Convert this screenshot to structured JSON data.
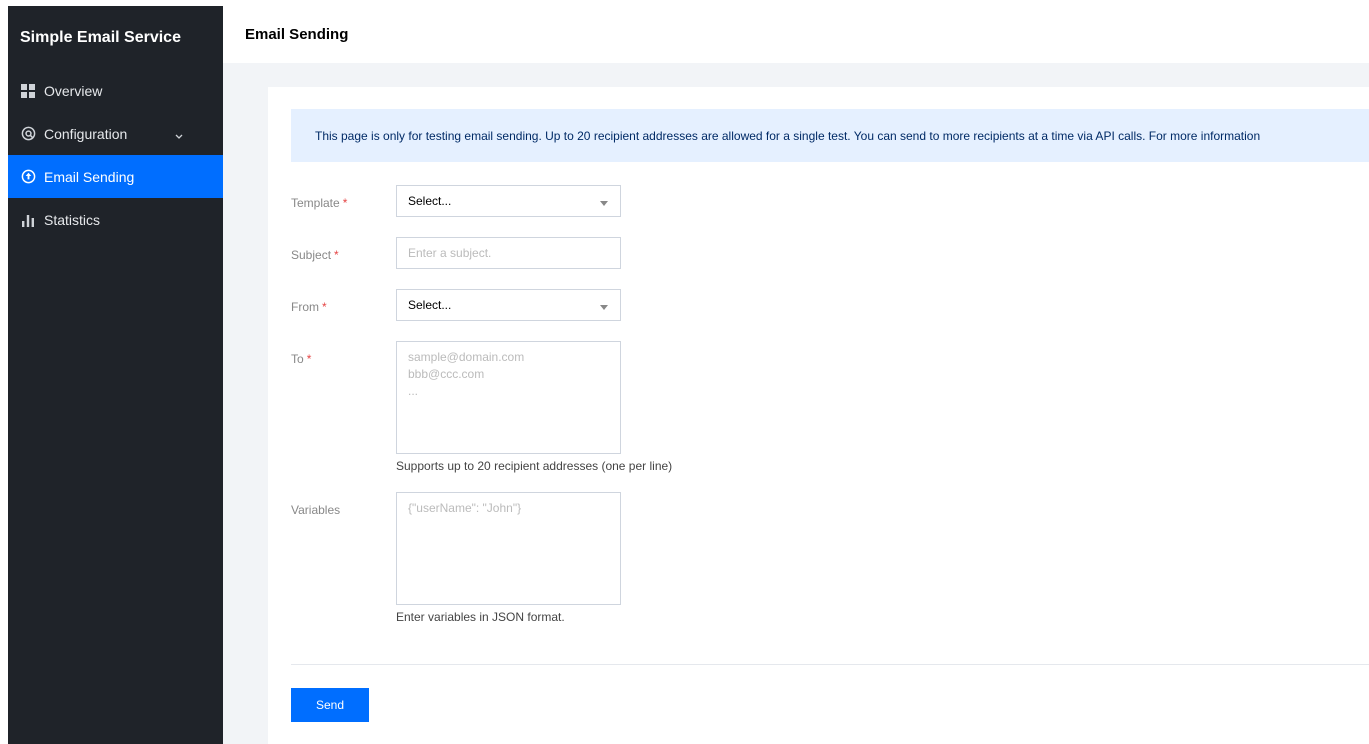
{
  "sidebar": {
    "title": "Simple Email Service",
    "items": [
      {
        "label": "Overview",
        "icon": "grid-icon"
      },
      {
        "label": "Configuration",
        "icon": "gear-circle-icon"
      },
      {
        "label": "Email Sending",
        "icon": "send-circle-icon",
        "active": true
      },
      {
        "label": "Statistics",
        "icon": "bar-chart-icon"
      }
    ]
  },
  "header": {
    "title": "Email Sending"
  },
  "notice": "This page is only for testing email sending. Up to 20 recipient addresses are allowed for a single test. You can send to more recipients at a time via API calls. For more information",
  "form": {
    "template": {
      "label": "Template",
      "value": "Select..."
    },
    "subject": {
      "label": "Subject",
      "placeholder": "Enter a subject."
    },
    "from": {
      "label": "From",
      "value": "Select..."
    },
    "to": {
      "label": "To",
      "placeholder": "sample@domain.com\nbbb@ccc.com\n...",
      "help": "Supports up to 20 recipient addresses (one per line)"
    },
    "variables": {
      "label": "Variables",
      "placeholder": "{\"userName\": \"John\"}",
      "help": "Enter variables in JSON format."
    },
    "required_mark": "*"
  },
  "actions": {
    "send_label": "Send"
  },
  "colors": {
    "accent": "#006eff",
    "sidebar_bg": "#1f2329",
    "notice_bg": "#e5f0ff",
    "required": "#e54545"
  }
}
